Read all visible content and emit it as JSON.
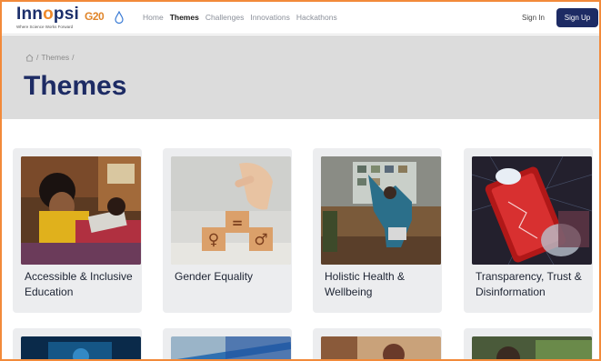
{
  "header": {
    "logo_text_1": "Inn",
    "logo_text_2": "o",
    "logo_text_3": "psi",
    "logo_tagline": "Where Science Works Forward",
    "g20_mark": "G20",
    "nav": [
      {
        "label": "Home",
        "active": false
      },
      {
        "label": "Themes",
        "active": true
      },
      {
        "label": "Challenges",
        "active": false
      },
      {
        "label": "Innovations",
        "active": false
      },
      {
        "label": "Hackathons",
        "active": false
      }
    ],
    "signin_label": "Sign In",
    "signup_label": "Sign Up"
  },
  "hero": {
    "breadcrumb_sep1": "/",
    "breadcrumb_item": "Themes",
    "breadcrumb_sep2": "/",
    "title": "Themes"
  },
  "cards": [
    {
      "title": "Accessible & Inclusive Education"
    },
    {
      "title": "Gender Equality"
    },
    {
      "title": "Holistic Health & Wellbeing"
    },
    {
      "title": "Transparency, Trust & Disinformation"
    }
  ],
  "colors": {
    "brand_navy": "#1d2b64",
    "accent_orange": "#f08a2b",
    "frame_orange": "#f28a3a",
    "hero_bg": "#dcdcdc",
    "card_bg": "#ecedef"
  },
  "icons": [
    "home-icon",
    "water-drop-icon"
  ]
}
